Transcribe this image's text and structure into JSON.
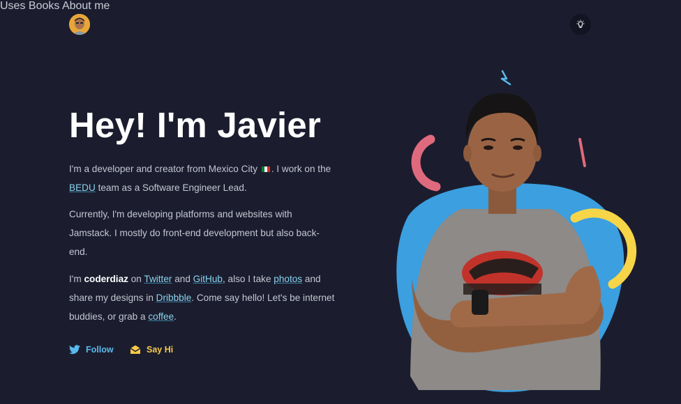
{
  "header": {
    "avatar_alt": "Javier avatar",
    "nav": [
      "Uses",
      "Books",
      "About me"
    ],
    "theme_toggle_icon": "lightbulb-icon"
  },
  "intro": {
    "title": "Hey! I'm Javier",
    "p1": {
      "t1": "I'm a developer and creator from Mexico City",
      "flag_icon": "mexico-flag-icon",
      "t2": ". I work on the",
      "link_bedu": "BEDU",
      "t3": "team as a Software Engineer Lead."
    },
    "p2": "Currently, I'm developing platforms and websites with Jamstack. I mostly do front-end development but also back-end.",
    "p3": {
      "t1": "I'm",
      "handle": "coderdiaz",
      "t2": "on",
      "link_twitter": "Twitter",
      "t3": "and",
      "link_github": "GitHub",
      "t4": ", also I take",
      "link_photos": "photos",
      "t5": "and share my designs in",
      "link_dribbble": "Dribbble",
      "t6": ". Come say hello! Let's be internet buddies, or grab a",
      "link_coffee": "coffee",
      "t7": "."
    },
    "cta": {
      "follow": "Follow",
      "follow_icon": "twitter-icon",
      "say_hi": "Say Hi",
      "say_hi_icon": "envelope-icon"
    }
  },
  "colors": {
    "background": "#1b1d2e",
    "blob_blue": "#3b9fe0",
    "accent_pink": "#e06a7d",
    "accent_yellow": "#f7d548",
    "link": "#8ad4f0"
  }
}
